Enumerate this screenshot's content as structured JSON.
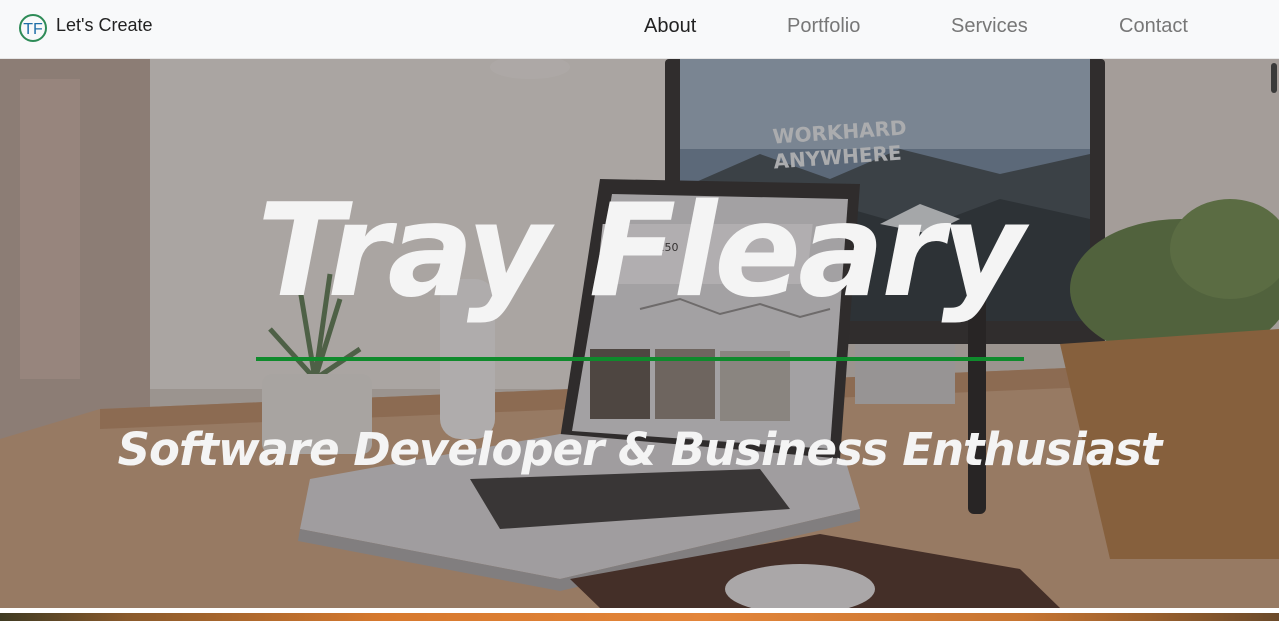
{
  "brand": {
    "logo_text": "TF",
    "name": "Let's Create"
  },
  "nav": {
    "items": [
      {
        "label": "About",
        "active": true
      },
      {
        "label": "Portfolio",
        "active": false
      },
      {
        "label": "Services",
        "active": false
      },
      {
        "label": "Contact",
        "active": false
      }
    ]
  },
  "hero": {
    "title": "Tray Fleary",
    "subtitle": "Software Developer & Business Enthusiast",
    "monitor_text": [
      "WORKHARD",
      "ANYWHERE"
    ],
    "laptop_value": "$6,250"
  },
  "colors": {
    "accent_rule": "#0f8a2c",
    "logo_green": "#2e8b57",
    "logo_blue": "#1f6fa8",
    "nav_active": "#222222",
    "nav_inactive": "#777777"
  }
}
